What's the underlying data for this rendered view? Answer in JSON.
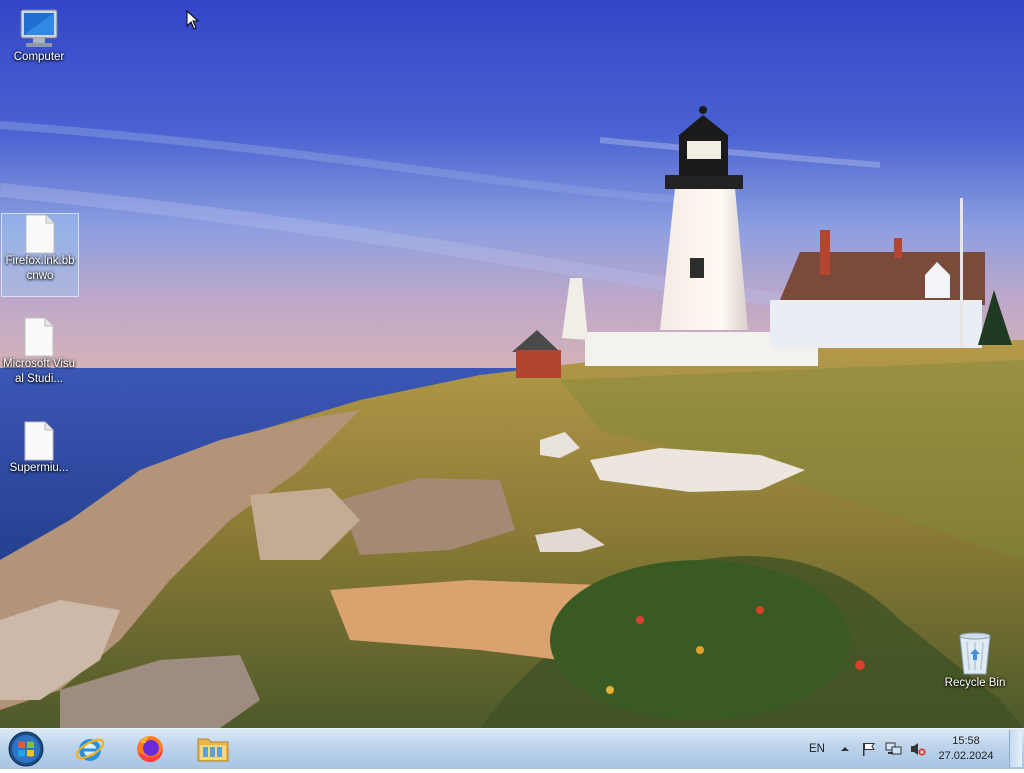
{
  "desktop": {
    "icons": [
      {
        "label": "Computer",
        "icon": "computer-icon"
      },
      {
        "label": "Firefox.lnk.bbcnwo",
        "icon": "file-icon",
        "selected": true
      },
      {
        "label": "Microsoft Visual Studi...",
        "icon": "file-icon"
      },
      {
        "label": "Supermiu...",
        "icon": "file-icon"
      },
      {
        "label": "Recycle Bin",
        "icon": "recycle-bin-icon"
      }
    ]
  },
  "taskbar": {
    "start_icon": "windows-start-icon",
    "pinned": [
      {
        "name": "internet-explorer",
        "icon": "internet-explorer-icon"
      },
      {
        "name": "firefox",
        "icon": "firefox-icon"
      },
      {
        "name": "file-explorer",
        "icon": "folder-icon"
      }
    ],
    "tray": {
      "language": "EN",
      "icons": [
        "chevron-up-icon",
        "flag-icon",
        "network-icon",
        "volume-muted-icon"
      ],
      "time": "15:58",
      "date": "27.02.2024"
    }
  },
  "colors": {
    "taskbar": "#b9d1ea",
    "sky": "#3a56c8",
    "sea": "#2e4ea8"
  }
}
